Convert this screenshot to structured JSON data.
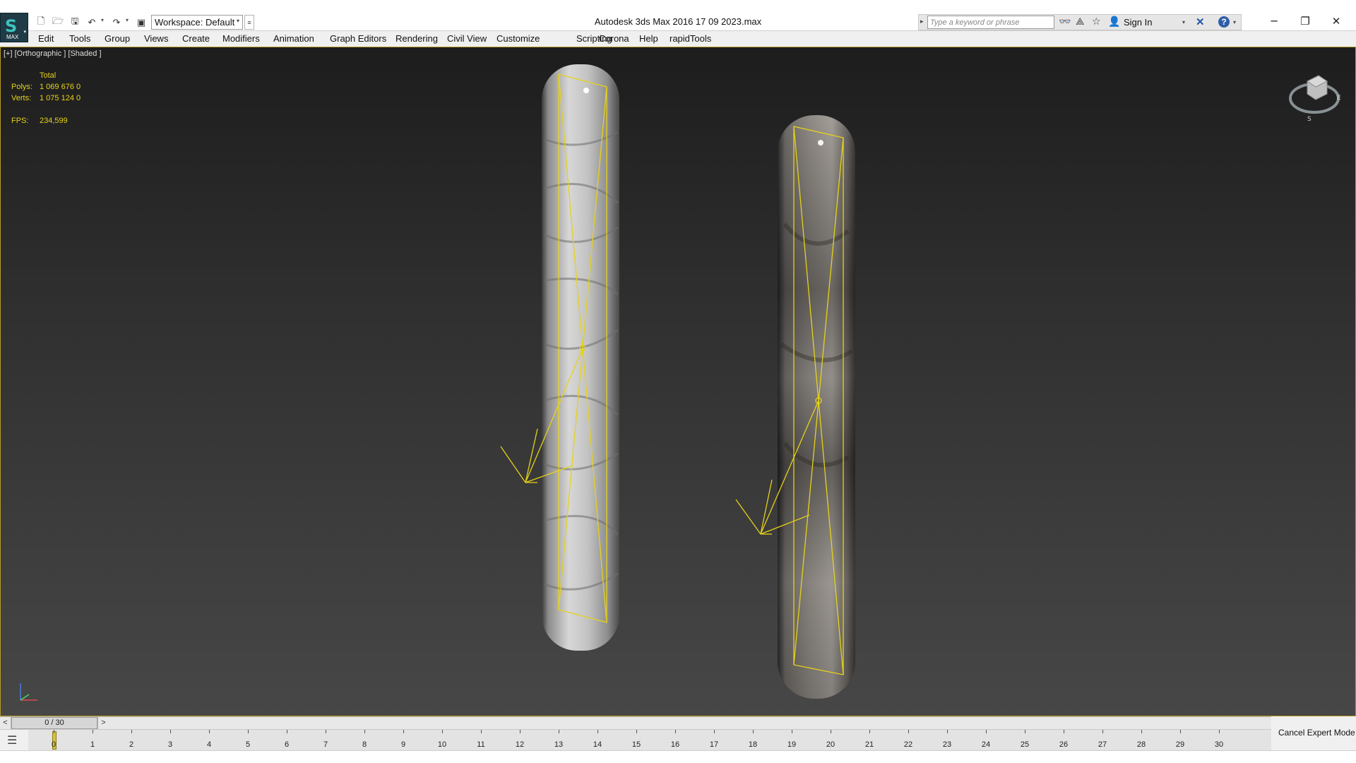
{
  "titlebar": {
    "workspace_label": "Workspace: Default",
    "window_title": "Autodesk 3ds Max 2016     17 09 2023.max",
    "search_placeholder": "Type a keyword or phrase",
    "sign_in": "Sign In"
  },
  "app_logo": {
    "symbol": "S",
    "caption": "MAX"
  },
  "menu": {
    "items": [
      "Edit",
      "Tools",
      "Group",
      "Views",
      "Create",
      "Modifiers",
      "Animation",
      "Graph Editors",
      "Rendering",
      "Civil View",
      "Customize",
      "Scripting",
      "Corona",
      "Help",
      "rapidTools"
    ]
  },
  "viewport": {
    "label": "[+] [Orthographic ] [Shaded ]",
    "stats": {
      "header": "Total",
      "polys_label": "Polys:",
      "polys_value": "1 069 676  0",
      "verts_label": "Verts:",
      "verts_value": "1 075 124  0",
      "fps_label": "FPS:",
      "fps_value": "234,599"
    },
    "border_color": "#b79c28",
    "selection_color": "#e6d219"
  },
  "timeslider": {
    "prev": "<",
    "position": "0 / 30",
    "next": ">"
  },
  "trackbar": {
    "frames": [
      "0",
      "1",
      "2",
      "3",
      "4",
      "5",
      "6",
      "7",
      "8",
      "9",
      "10",
      "11",
      "12",
      "13",
      "14",
      "15",
      "16",
      "17",
      "18",
      "19",
      "20",
      "21",
      "22",
      "23",
      "24",
      "25",
      "26",
      "27",
      "28",
      "29",
      "30"
    ]
  },
  "status": {
    "cancel_expert": "Cancel Expert Mode"
  },
  "icons": {
    "new": "new-file-icon",
    "open": "open-file-icon",
    "save": "save-icon",
    "undo": "undo-icon",
    "redo": "redo-icon",
    "project": "project-folder-icon",
    "binoculars": "binoculars-icon",
    "subscription": "subscription-icon",
    "favorites": "star-icon",
    "user": "user-icon",
    "exchange": "autodesk-exchange-icon",
    "help": "help-icon"
  }
}
